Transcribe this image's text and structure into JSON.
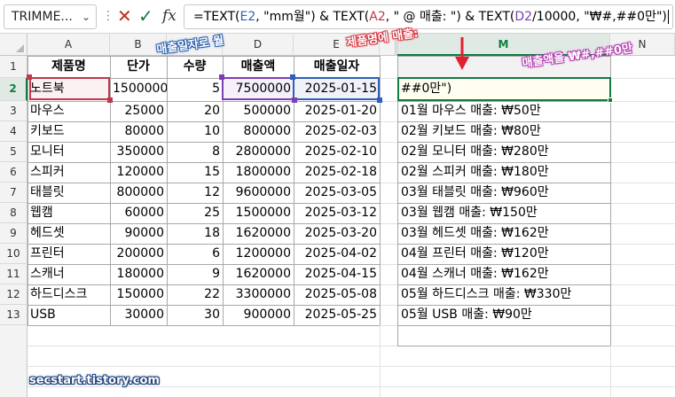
{
  "formula_bar": {
    "name_box": "TRIMME...",
    "chevron": "⌄",
    "dots": "⋮",
    "cancel": "✕",
    "enter": "✓",
    "fx": "fx",
    "f0": "=TEXT(",
    "f1": "E2",
    "f2": ", \"mm월\") & TEXT(",
    "f3": "A2",
    "f4": ", \" @ 매출: \") & TEXT(",
    "f5": "D2",
    "f6": "/10000, \"₩#,##0만\")"
  },
  "columns": [
    "A",
    "B",
    "C",
    "D",
    "E",
    "M",
    "N"
  ],
  "rows": [
    "1",
    "2",
    "3",
    "4",
    "5",
    "6",
    "7",
    "8",
    "9",
    "10",
    "11",
    "12",
    "13"
  ],
  "headers": {
    "name": "제품명",
    "price": "단가",
    "qty": "수량",
    "sales": "매출액",
    "date": "매출일자"
  },
  "products": [
    {
      "name": "노트북",
      "price": "1500000",
      "qty": "5",
      "sales": "7500000",
      "date": "2025-01-15",
      "m": "##0만\")"
    },
    {
      "name": "마우스",
      "price": "25000",
      "qty": "20",
      "sales": "500000",
      "date": "2025-01-20",
      "m": "01월 마우스 매출: ₩50만"
    },
    {
      "name": "키보드",
      "price": "80000",
      "qty": "10",
      "sales": "800000",
      "date": "2025-02-03",
      "m": "02월 키보드 매출: ₩80만"
    },
    {
      "name": "모니터",
      "price": "350000",
      "qty": "8",
      "sales": "2800000",
      "date": "2025-02-10",
      "m": "02월 모니터 매출: ₩280만"
    },
    {
      "name": "스피커",
      "price": "120000",
      "qty": "15",
      "sales": "1800000",
      "date": "2025-02-18",
      "m": "02월 스피커 매출: ₩180만"
    },
    {
      "name": "태블릿",
      "price": "800000",
      "qty": "12",
      "sales": "9600000",
      "date": "2025-03-05",
      "m": "03월 태블릿 매출: ₩960만"
    },
    {
      "name": "웹캠",
      "price": "60000",
      "qty": "25",
      "sales": "1500000",
      "date": "2025-03-12",
      "m": "03월 웹캠 매출: ₩150만"
    },
    {
      "name": "헤드셋",
      "price": "90000",
      "qty": "18",
      "sales": "1620000",
      "date": "2025-03-20",
      "m": "03월 헤드셋 매출: ₩162만"
    },
    {
      "name": "프린터",
      "price": "200000",
      "qty": "6",
      "sales": "1200000",
      "date": "2025-04-02",
      "m": "04월 프린터 매출: ₩120만"
    },
    {
      "name": "스캐너",
      "price": "180000",
      "qty": "9",
      "sales": "1620000",
      "date": "2025-04-15",
      "m": "04월 스캐너 매출: ₩162만"
    },
    {
      "name": "하드디스크",
      "price": "150000",
      "qty": "22",
      "sales": "3300000",
      "date": "2025-05-08",
      "m": "05월 하드디스크 매출: ₩330만"
    },
    {
      "name": "USB",
      "price": "30000",
      "qty": "30",
      "sales": "900000",
      "date": "2025-05-25",
      "m": "05월 USB 매출: ₩90만"
    }
  ],
  "annotations": {
    "a1": "매출일자로 월",
    "a2": "제품명에 매출:",
    "a3": "매출액을 ₩#,##0만"
  },
  "watermark": "secstart.tistory.com",
  "colors": {
    "accent": "#107c41",
    "ref_e": "#2f5fb8",
    "ref_a": "#c0394a",
    "ref_d": "#7b3fb4"
  }
}
